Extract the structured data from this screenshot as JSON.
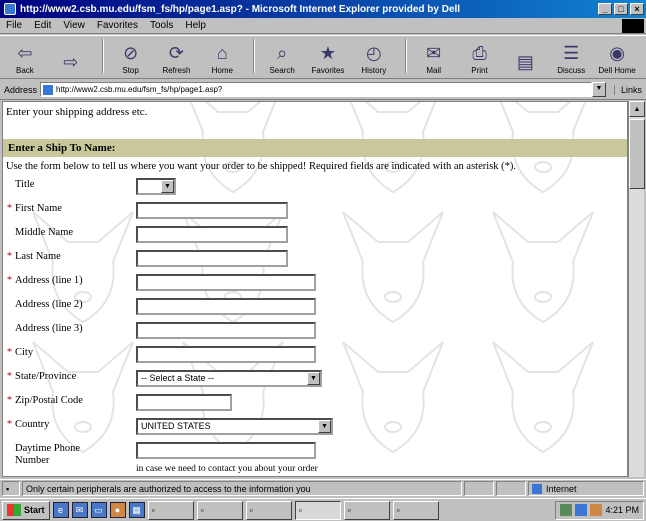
{
  "window": {
    "title": "http://www2.csb.mu.edu/fsm_fs/hp/page1.asp? - Microsoft Internet Explorer provided by Dell",
    "controls": {
      "minimize": "_",
      "maximize": "□",
      "close": "×"
    }
  },
  "menubar": {
    "items": [
      "File",
      "Edit",
      "View",
      "Favorites",
      "Tools",
      "Help"
    ]
  },
  "toolbar": {
    "buttons": [
      {
        "label": "Back",
        "icon": "back-arrow-icon",
        "glyph": "⇦"
      },
      {
        "label": "",
        "icon": "forward-arrow-icon",
        "glyph": "⇨"
      },
      {
        "label": "Stop",
        "icon": "stop-icon",
        "glyph": "⊘"
      },
      {
        "label": "Refresh",
        "icon": "refresh-icon",
        "glyph": "⟳"
      },
      {
        "label": "Home",
        "icon": "home-icon",
        "glyph": "⌂"
      },
      {
        "label": "Search",
        "icon": "search-icon",
        "glyph": "⌕"
      },
      {
        "label": "Favorites",
        "icon": "favorites-icon",
        "glyph": "★"
      },
      {
        "label": "History",
        "icon": "history-icon",
        "glyph": "◴"
      },
      {
        "label": "Mail",
        "icon": "mail-icon",
        "glyph": "✉"
      },
      {
        "label": "Print",
        "icon": "print-icon",
        "glyph": "⎙"
      },
      {
        "label": "",
        "icon": "edit-icon",
        "glyph": "▤"
      },
      {
        "label": "Discuss",
        "icon": "discuss-icon",
        "glyph": "☰"
      },
      {
        "label": "Dell Home",
        "icon": "dell-home-icon",
        "glyph": "◉"
      }
    ]
  },
  "address": {
    "label": "Address",
    "url": "http://www2.csb.mu.edu/fsm_fs/hp/page1.asp?",
    "links_label": "Links"
  },
  "page": {
    "intro": "Enter your shipping address etc.",
    "section_title": "Enter a Ship To Name:",
    "instructions": "Use the form below to tell us where you want your order to be shipped! Required fields are indicated with an asterisk (*).",
    "fields": [
      {
        "label": "Title",
        "required": false,
        "kind": "select",
        "value": "",
        "width": "small"
      },
      {
        "label": "First Name",
        "required": true,
        "kind": "text",
        "value": ""
      },
      {
        "label": "Middle Name",
        "required": false,
        "kind": "text",
        "value": ""
      },
      {
        "label": "Last Name",
        "required": true,
        "kind": "text",
        "value": ""
      },
      {
        "label": "Address (line 1)",
        "required": true,
        "kind": "text",
        "value": ""
      },
      {
        "label": "Address (line 2)",
        "required": false,
        "kind": "text",
        "value": ""
      },
      {
        "label": "Address (line 3)",
        "required": false,
        "kind": "text",
        "value": ""
      },
      {
        "label": "City",
        "required": true,
        "kind": "text",
        "value": ""
      },
      {
        "label": "State/Province",
        "required": true,
        "kind": "select",
        "value": "-- Select a State --"
      },
      {
        "label": "Zip/Postal Code",
        "required": true,
        "kind": "text",
        "value": ""
      },
      {
        "label": "Country",
        "required": true,
        "kind": "select",
        "value": "UNITED STATES"
      },
      {
        "label": "Daytime Phone Number",
        "required": false,
        "kind": "text",
        "value": "",
        "hint": "in case we need to contact you about your order"
      }
    ]
  },
  "statusbar": {
    "message": "Only certain peripherals are authorized to access to the information you",
    "zone": "Internet"
  },
  "taskbar": {
    "start_label": "Start",
    "quicklaunch": [
      "ie-icon",
      "outlook-icon",
      "desktop-icon",
      "media-icon",
      "channel-icon"
    ],
    "tasks": [
      "",
      "",
      "",
      "",
      "",
      ""
    ],
    "time": "4:21 PM"
  },
  "colors": {
    "section_header": "#c9c89a",
    "required_asterisk": "#c00000",
    "titlebar": "#00007f"
  }
}
